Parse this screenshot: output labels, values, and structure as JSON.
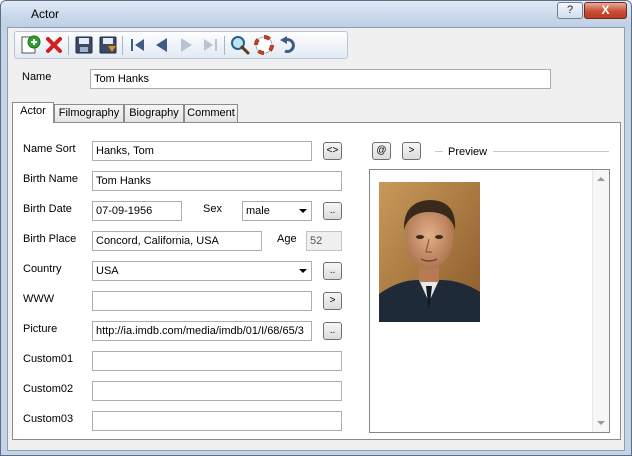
{
  "window": {
    "title": "Actor",
    "help_label": "?",
    "close_label": "X"
  },
  "toolbar": {
    "buttons": [
      {
        "name": "add-icon"
      },
      {
        "name": "delete-icon"
      },
      {
        "name": "save-icon"
      },
      {
        "name": "save-as-icon"
      },
      {
        "name": "first-record-icon"
      },
      {
        "name": "previous-record-icon"
      },
      {
        "name": "next-record-icon"
      },
      {
        "name": "last-record-icon"
      },
      {
        "name": "search-icon"
      },
      {
        "name": "help-lifebuoy-icon"
      },
      {
        "name": "undo-icon"
      }
    ]
  },
  "header": {
    "name_label": "Name",
    "name_value": "Tom Hanks"
  },
  "tabs": [
    {
      "label": "Actor",
      "active": true
    },
    {
      "label": "Filmography",
      "active": false
    },
    {
      "label": "Biography",
      "active": false
    },
    {
      "label": "Comment",
      "active": false
    }
  ],
  "form": {
    "name_sort": {
      "label": "Name Sort",
      "value": "Hanks, Tom",
      "button": "<>"
    },
    "birth_name": {
      "label": "Birth Name",
      "value": "Tom Hanks"
    },
    "birth_date": {
      "label": "Birth Date",
      "value": "07-09-1956"
    },
    "sex": {
      "label": "Sex",
      "value": "male",
      "button": ".."
    },
    "birth_place": {
      "label": "Birth Place",
      "value": "Concord, California, USA"
    },
    "age": {
      "label": "Age",
      "value": "52"
    },
    "country": {
      "label": "Country",
      "value": "USA",
      "button": ".."
    },
    "www": {
      "label": "WWW",
      "value": "",
      "button": ">"
    },
    "picture": {
      "label": "Picture",
      "value": "http://ia.imdb.com/media/imdb/01/I/68/65/3",
      "button": ".."
    },
    "custom01": {
      "label": "Custom01",
      "value": ""
    },
    "custom02": {
      "label": "Custom02",
      "value": ""
    },
    "custom03": {
      "label": "Custom03",
      "value": ""
    }
  },
  "preview": {
    "label": "Preview",
    "at_button": "@",
    "go_button": ">"
  },
  "colors": {
    "accent": "#3c7fb1",
    "close": "#c94f36"
  }
}
